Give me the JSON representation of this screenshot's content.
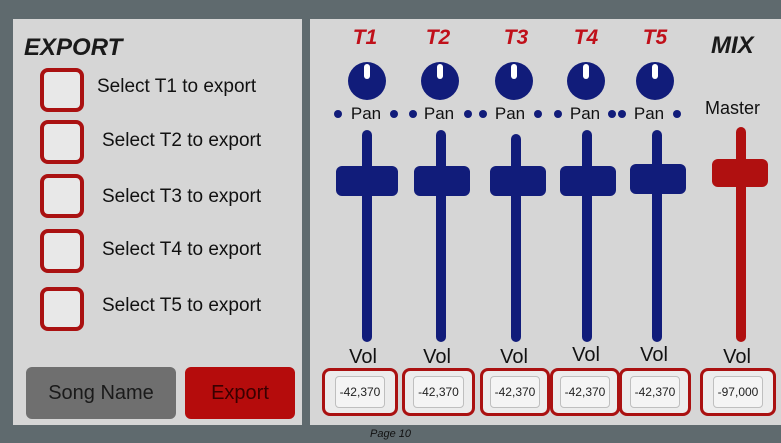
{
  "export": {
    "title": "EXPORT",
    "items": [
      {
        "label": "Select T1 to export"
      },
      {
        "label": "Select T2 to export"
      },
      {
        "label": "Select T3 to export"
      },
      {
        "label": "Select T4 to export"
      },
      {
        "label": "Select T5 to export"
      }
    ],
    "song_name_label": "Song Name",
    "export_label": "Export"
  },
  "mix": {
    "title": "MIX",
    "tracks": [
      {
        "name": "T1",
        "pan": "Pan",
        "vol": "Vol",
        "value": "-42,370"
      },
      {
        "name": "T2",
        "pan": "Pan",
        "vol": "Vol",
        "value": "-42,370"
      },
      {
        "name": "T3",
        "pan": "Pan",
        "vol": "Vol",
        "value": "-42,370"
      },
      {
        "name": "T4",
        "pan": "Pan",
        "vol": "Vol",
        "value": "-42,370"
      },
      {
        "name": "T5",
        "pan": "Pan",
        "vol": "Vol",
        "value": "-42,370"
      }
    ],
    "master": {
      "name": "Master",
      "vol": "Vol",
      "value": "-97,000"
    }
  },
  "footer": {
    "page": "Page 10"
  },
  "colors": {
    "track_blue": "#111c7a",
    "accent_red": "#b50c0c",
    "panel_bg": "#d6d6d6"
  },
  "icons": {
    "pan_knob": "knob-icon",
    "pan_dot": "dot-icon"
  }
}
